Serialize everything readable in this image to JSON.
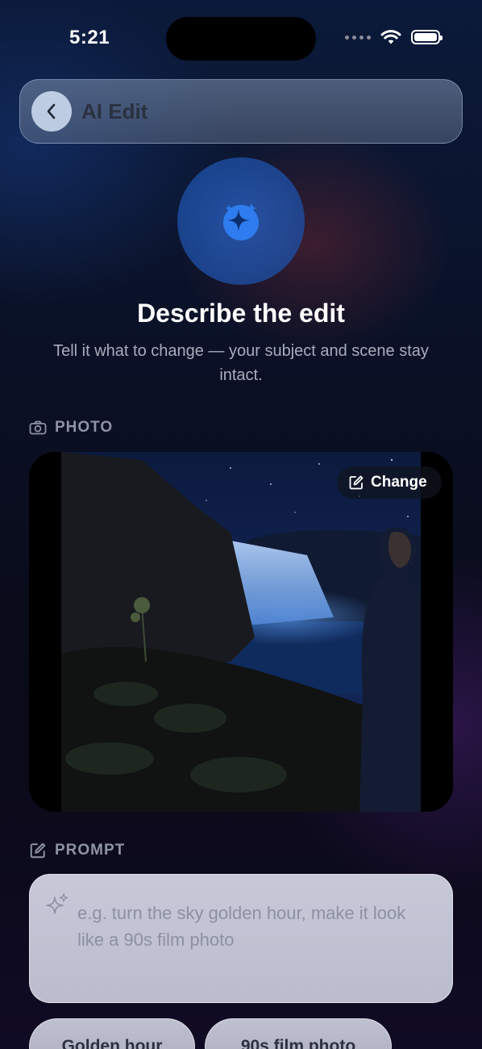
{
  "status_bar": {
    "time": "5:21"
  },
  "nav": {
    "title": "AI Edit"
  },
  "hero": {
    "title": "Describe the edit",
    "subtitle": "Tell it what to change — your subject and scene stay intact."
  },
  "photo_section": {
    "label": "PHOTO",
    "change_label": "Change"
  },
  "prompt_section": {
    "label": "PROMPT",
    "placeholder": "e.g. turn the sky golden hour, make it look like a 90s film photo"
  },
  "suggestions": [
    "Golden hour",
    "90s film photo"
  ],
  "colors": {
    "accent": "#2f7cf0",
    "hero_circle": "#23569f"
  }
}
